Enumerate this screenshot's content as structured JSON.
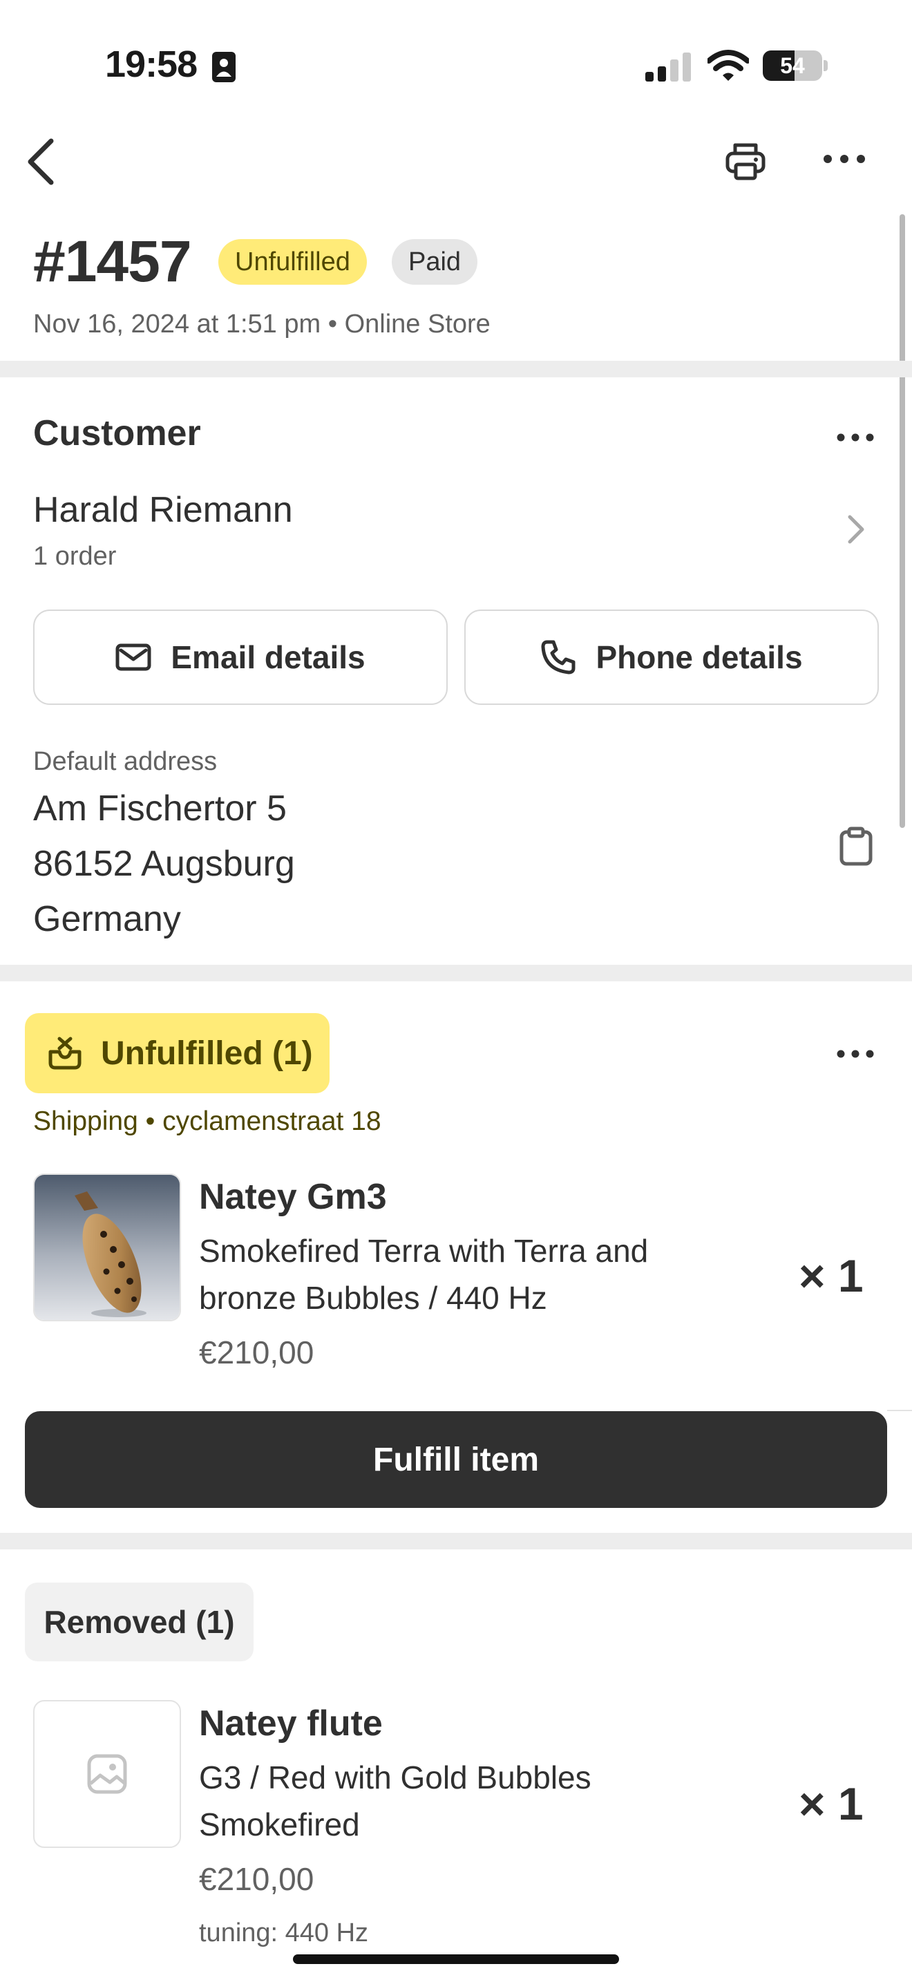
{
  "status_bar": {
    "time": "19:58",
    "battery_level": "54",
    "battery_fraction": 0.54
  },
  "order": {
    "number": "#1457",
    "fulfillment_badge": "Unfulfilled",
    "payment_badge": "Paid",
    "meta": "Nov 16, 2024 at 1:51 pm • Online Store"
  },
  "customer": {
    "section_title": "Customer",
    "name": "Harald Riemann",
    "order_count": "1 order",
    "email_button": "Email details",
    "phone_button": "Phone details",
    "address_label": "Default address",
    "address_lines": [
      "Am Fischertor 5",
      "86152 Augsburg",
      "Germany"
    ]
  },
  "unfulfilled": {
    "label": "Unfulfilled (1)",
    "shipping": "Shipping • cyclamenstraat 18",
    "item": {
      "title": "Natey Gm3",
      "variant_lines": [
        "Smokefired Terra with Terra and",
        "bronze Bubbles / 440 Hz"
      ],
      "price": "€210,00",
      "quantity": "× 1"
    },
    "fulfill_button": "Fulfill item"
  },
  "removed": {
    "label": "Removed (1)",
    "item": {
      "title": "Natey flute",
      "variant_lines": [
        "G3 / Red with Gold Bubbles",
        "Smokefired"
      ],
      "price": "€210,00",
      "property": "tuning: 440 Hz",
      "quantity": "× 1"
    }
  },
  "icons": {
    "back": "chevron-left-icon",
    "print": "printer-icon",
    "more": "more-horizontal-icon",
    "email": "envelope-icon",
    "phone": "phone-icon",
    "copy": "clipboard-icon",
    "fulfillment": "package-icon",
    "placeholder": "image-placeholder-icon"
  },
  "colors": {
    "unfulfilled_bg": "#ffeb78",
    "unfulfilled_text": "#4f4700",
    "primary_button": "#303030",
    "muted_text": "#616161"
  }
}
